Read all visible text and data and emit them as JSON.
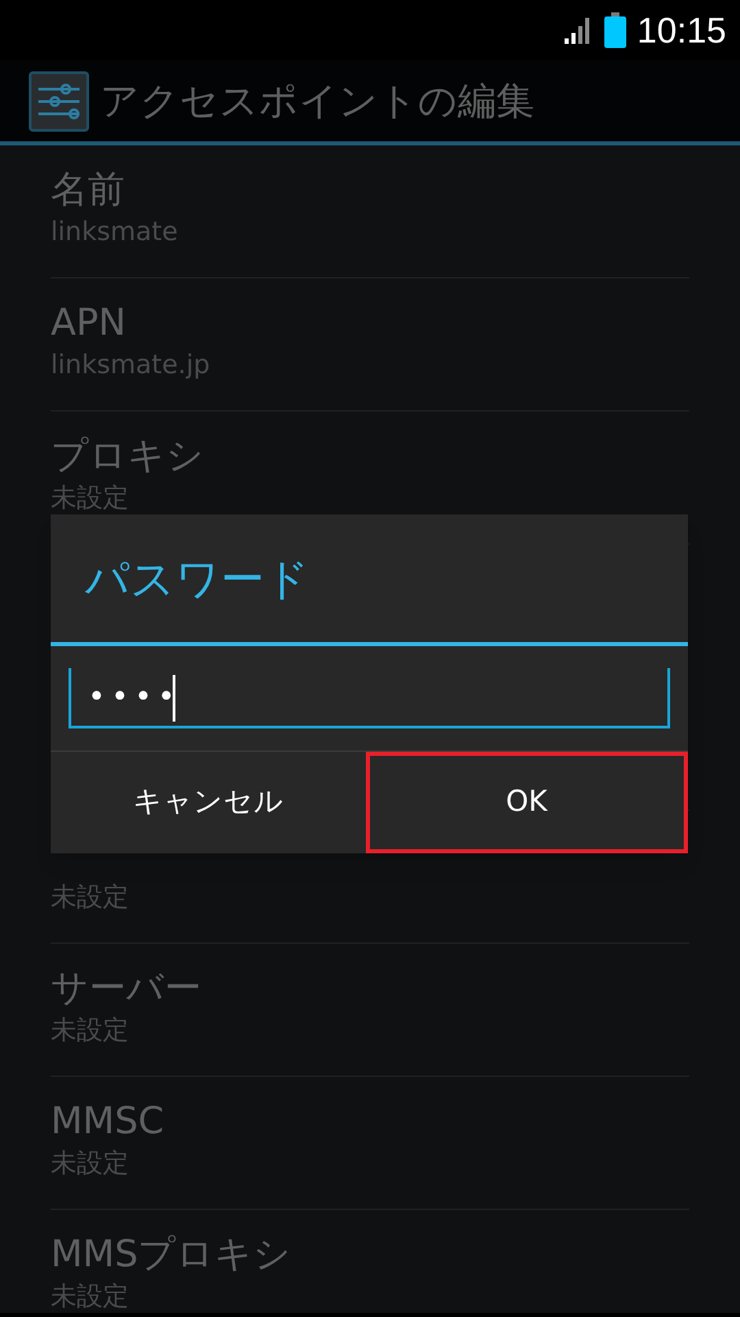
{
  "status_bar": {
    "time": "10:15"
  },
  "action_bar": {
    "title": "アクセスポイントの編集"
  },
  "settings_top": [
    {
      "label": "名前",
      "summary": "linksmate"
    },
    {
      "label": "APN",
      "summary": "linksmate.jp"
    },
    {
      "label": "プロキシ",
      "summary": "未設定"
    }
  ],
  "settings_bottom": [
    {
      "summary": "未設定"
    },
    {
      "label": "サーバー",
      "summary": "未設定"
    },
    {
      "label": "MMSC",
      "summary": "未設定"
    },
    {
      "label": "MMSプロキシ",
      "summary": "未設定"
    }
  ],
  "dialog": {
    "title": "パスワード",
    "value": "••••",
    "buttons": [
      {
        "label": "キャンセル",
        "highlighted": false
      },
      {
        "label": "OK",
        "highlighted": true
      }
    ]
  }
}
